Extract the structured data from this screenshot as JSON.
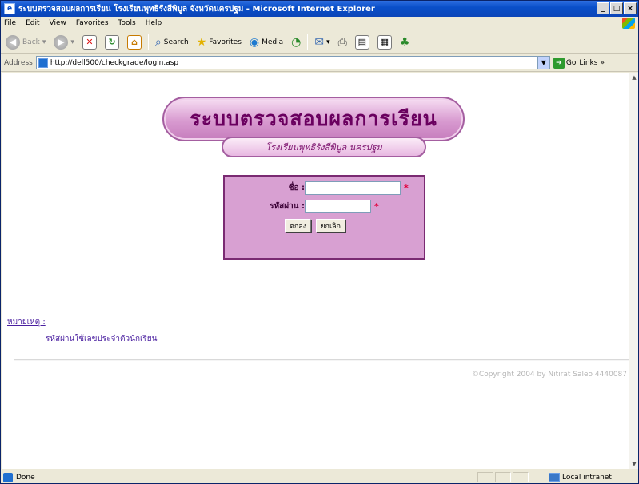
{
  "window": {
    "title": "ระบบตรวจสอบผลการเรียน โรงเรียนพุทธิรังสีพิบูล จังหวัดนครปฐม - Microsoft Internet Explorer",
    "controls": {
      "minimize": "_",
      "maximize": "□",
      "close": "×"
    }
  },
  "menu": [
    "File",
    "Edit",
    "View",
    "Favorites",
    "Tools",
    "Help"
  ],
  "toolbar": {
    "back": "Back",
    "search": "Search",
    "favorites": "Favorites",
    "media": "Media"
  },
  "address": {
    "label": "Address",
    "url": "http://dell500/checkgrade/login.asp",
    "go": "Go",
    "links": "Links"
  },
  "page": {
    "banner_title": "ระบบตรวจสอบผลการเรียน",
    "banner_subtitle": "โรงเรียนพุทธิรังสีพิบูล นครปฐม",
    "login": {
      "name_label": "ชื่อ :",
      "password_label": "รหัสผ่าน :",
      "name_value": "",
      "password_value": "",
      "required_mark": "*",
      "submit": "ตกลง",
      "cancel": "ยกเลิก"
    },
    "note_title": "หมายเหตุ :",
    "note_text": "รหัสผ่านใช้เลขประจำตัวนักเรียน",
    "copyright": "©Copyright 2004 by Nitirat Saleo 4440087"
  },
  "status": {
    "text": "Done",
    "zone": "Local intranet"
  }
}
